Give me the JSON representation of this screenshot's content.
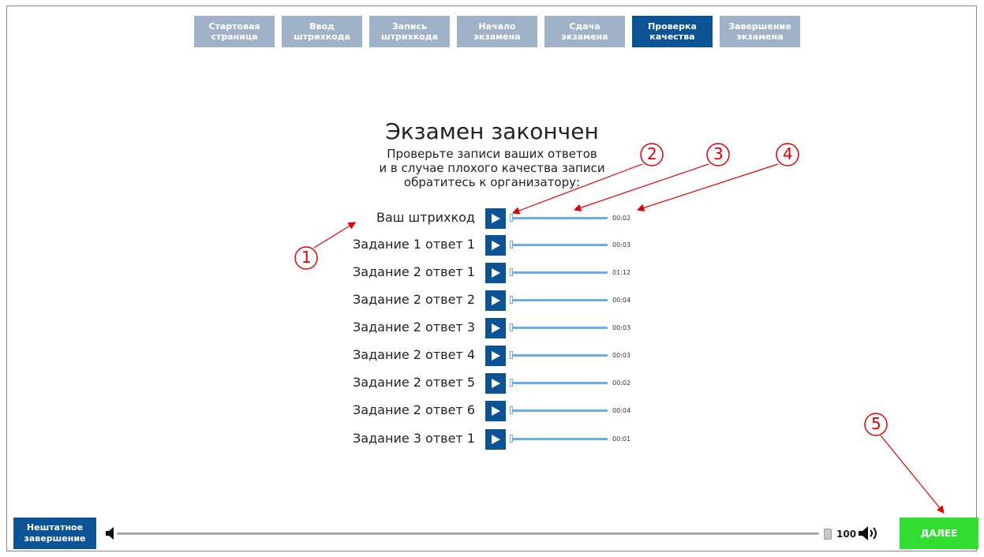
{
  "steps": [
    {
      "label": "Стартовая\nстраница"
    },
    {
      "label": "Ввод\nштрихкода"
    },
    {
      "label": "Запись\nштрихкода"
    },
    {
      "label": "Начало\nэкзамена"
    },
    {
      "label": "Сдача\nэкзамена"
    },
    {
      "label": "Проверка\nкачества"
    },
    {
      "label": "Завершение\nэкзамена"
    }
  ],
  "active_step": "Проверка\nкачества",
  "main": {
    "title": "Экзамен закончен",
    "subtitle": "Проверьте записи ваших ответов\nи в случае плохого качества записи\nобратитесь к организатору:"
  },
  "recordings": [
    {
      "label": "Ваш штрихкод",
      "time": "00:02"
    },
    {
      "label": "Задание 1 ответ 1",
      "time": "00:03"
    },
    {
      "label": "Задание 2 ответ 1",
      "time": "01:12"
    },
    {
      "label": "Задание 2 ответ 2",
      "time": "00:04"
    },
    {
      "label": "Задание 2 ответ 3",
      "time": "00:03"
    },
    {
      "label": "Задание 2 ответ 4",
      "time": "00:03"
    },
    {
      "label": "Задание 2 ответ 5",
      "time": "00:02"
    },
    {
      "label": "Задание 2 ответ 6",
      "time": "00:04"
    },
    {
      "label": "Задание 3 ответ 1",
      "time": "00:01"
    }
  ],
  "annotations": [
    "1",
    "2",
    "3",
    "4",
    "5"
  ],
  "footer": {
    "abort_label": "Нештатное\nзавершение",
    "volume": "100",
    "next_label": "ДАЛЕЕ"
  },
  "colors": {
    "accent": "#0b5394",
    "inactive_step": "#9fb2c7",
    "next": "#32dd32",
    "annotation": "#e00000"
  },
  "icons": [
    "play-icon",
    "volume-mute-icon",
    "volume-high-icon"
  ]
}
